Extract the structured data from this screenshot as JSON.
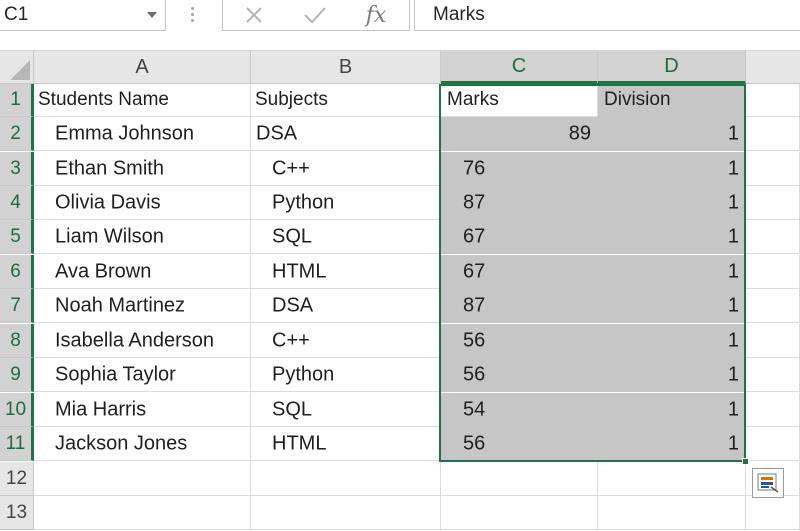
{
  "formula_bar": {
    "name_box": "C1",
    "formula": "Marks",
    "cancel_icon": "close-icon",
    "enter_icon": "checkmark-icon",
    "fx_label": "fx"
  },
  "columns": [
    "A",
    "B",
    "C",
    "D"
  ],
  "rows": [
    "1",
    "2",
    "3",
    "4",
    "5",
    "6",
    "7",
    "8",
    "9",
    "10",
    "11",
    "12",
    "13"
  ],
  "headers": {
    "a": "Students Name",
    "b": "Subjects",
    "c": "Marks",
    "d": "Division"
  },
  "data": [
    {
      "name": "Emma Johnson",
      "subject": "DSA",
      "marks": "89",
      "division": "1"
    },
    {
      "name": "Ethan Smith",
      "subject": "C++",
      "marks": "76",
      "division": "1"
    },
    {
      "name": "Olivia Davis",
      "subject": "Python",
      "marks": "87",
      "division": "1"
    },
    {
      "name": "Liam Wilson",
      "subject": "SQL",
      "marks": "67",
      "division": "1"
    },
    {
      "name": "Ava Brown",
      "subject": "HTML",
      "marks": "67",
      "division": "1"
    },
    {
      "name": "Noah Martinez",
      "subject": "DSA",
      "marks": "87",
      "division": "1"
    },
    {
      "name": "Isabella Anderson",
      "subject": "C++",
      "marks": "56",
      "division": "1"
    },
    {
      "name": "Sophia Taylor",
      "subject": "Python",
      "marks": "56",
      "division": "1"
    },
    {
      "name": "Mia Harris",
      "subject": "SQL",
      "marks": "54",
      "division": "1"
    },
    {
      "name": "Jackson Jones",
      "subject": "HTML",
      "marks": "56",
      "division": "1"
    }
  ],
  "colors": {
    "selection_border": "#217346",
    "selected_fill": "#c6c6c6",
    "header_fill": "#e6e6e6"
  }
}
